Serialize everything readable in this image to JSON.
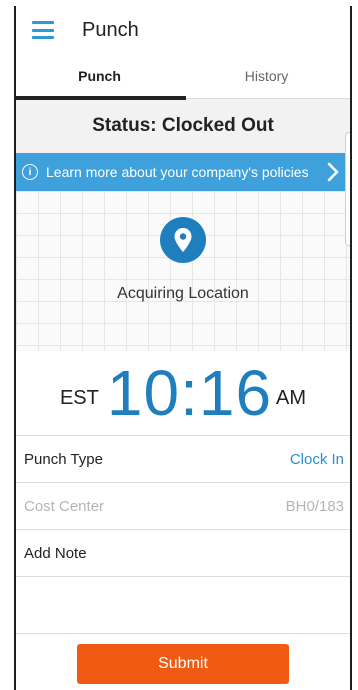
{
  "header": {
    "title": "Punch",
    "menu_icon": "hamburger-icon"
  },
  "tabs": [
    {
      "label": "Punch",
      "active": true
    },
    {
      "label": "History",
      "active": false
    }
  ],
  "status": {
    "text": "Status: Clocked Out"
  },
  "banner": {
    "text": "Learn more about your company's policies",
    "icon": "info-icon",
    "color": "#3fa1dc"
  },
  "location": {
    "text": "Acquiring Location",
    "icon": "location-pin-icon"
  },
  "clock": {
    "timezone": "EST",
    "time": "10:16",
    "ampm": "AM",
    "color": "#1f7fbe"
  },
  "form": {
    "punch_type": {
      "label": "Punch Type",
      "value": "Clock In"
    },
    "cost_center": {
      "label": "Cost Center",
      "value": "BH0/183"
    },
    "add_note": {
      "label": "Add Note"
    }
  },
  "footer": {
    "submit_label": "Submit",
    "submit_color": "#f05a12"
  }
}
